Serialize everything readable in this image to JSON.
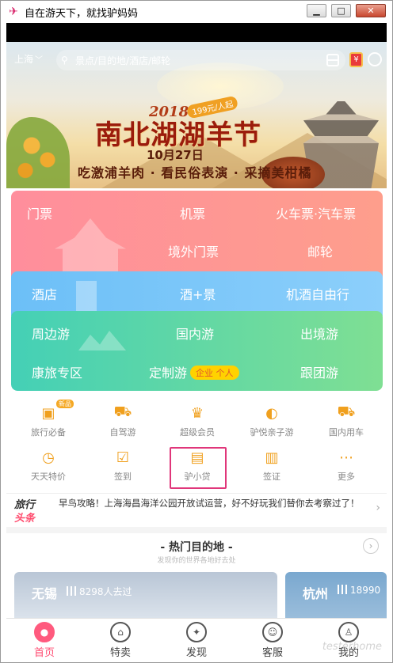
{
  "window": {
    "title": "自在游天下，就找驴妈妈",
    "minimize": "▁",
    "maximize": "□",
    "close": "✕"
  },
  "header": {
    "city": "上海",
    "search_placeholder": "景点/目的地/酒店/邮轮"
  },
  "banner": {
    "year": "2018",
    "badge": "199元/人起",
    "title": "南北湖湖羊节",
    "date": "10月27日",
    "subtitle": "吃激浦羊肉 · 看民俗表演 · 采摘美柑橘"
  },
  "grid": {
    "row1": [
      "门票",
      "机票",
      "火车票·汽车票"
    ],
    "row2": [
      "境外门票",
      "邮轮"
    ],
    "row3": [
      "酒店",
      "酒+景",
      "机酒自由行"
    ],
    "row4": [
      "周边游",
      "国内游",
      "出境游"
    ],
    "row5": [
      "康旅专区",
      "定制游",
      "跟团游"
    ],
    "custom_tag": "企业 个人"
  },
  "icons": [
    {
      "label": "旅行必备",
      "icon": "suitcase-icon",
      "symbol": "▣",
      "new_badge": "新品"
    },
    {
      "label": "自驾游",
      "icon": "car-icon",
      "symbol": "⛟"
    },
    {
      "label": "超级会员",
      "icon": "crown-icon",
      "symbol": "♛"
    },
    {
      "label": "驴悦亲子游",
      "icon": "balloon-icon",
      "symbol": "◐"
    },
    {
      "label": "国内用车",
      "icon": "vehicle-icon",
      "symbol": "⛟"
    },
    {
      "label": "天天特价",
      "icon": "clock-icon",
      "symbol": "◷"
    },
    {
      "label": "签到",
      "icon": "calendar-check-icon",
      "symbol": "☑"
    },
    {
      "label": "驴小贷",
      "icon": "wallet-icon",
      "symbol": "▤"
    },
    {
      "label": "签证",
      "icon": "passport-icon",
      "symbol": "▥"
    },
    {
      "label": "更多",
      "icon": "more-icon",
      "symbol": "⋯"
    }
  ],
  "news": {
    "logo_line1": "旅行",
    "logo_line2": "头条",
    "text": "早鸟攻略！上海海昌海洋公园开放试运营，好不好玩我们替你去考察过了！",
    "arrow": "›"
  },
  "hot": {
    "title": "- 热门目的地 -",
    "subtitle": "发现你的世界各地好去处",
    "arrow": "›"
  },
  "cards": [
    {
      "city": "无锡",
      "stat": "8298人去过"
    },
    {
      "city": "杭州",
      "stat": "18990"
    }
  ],
  "tabs": [
    {
      "label": "首页",
      "icon": "home-icon",
      "symbol": "●",
      "active": true
    },
    {
      "label": "特卖",
      "icon": "bag-icon",
      "symbol": "⌂"
    },
    {
      "label": "发现",
      "icon": "compass-icon",
      "symbol": "✦"
    },
    {
      "label": "客服",
      "icon": "service-icon",
      "symbol": "☺"
    },
    {
      "label": "我的",
      "icon": "profile-icon",
      "symbol": "♙"
    }
  ],
  "watermark": "testerhome",
  "colors": {
    "accent": "#ff4c72",
    "tickets": "#ff8e9c",
    "hotel": "#6cbff7",
    "tours": "#44d0b6",
    "highlight_box": "#e0367a"
  }
}
